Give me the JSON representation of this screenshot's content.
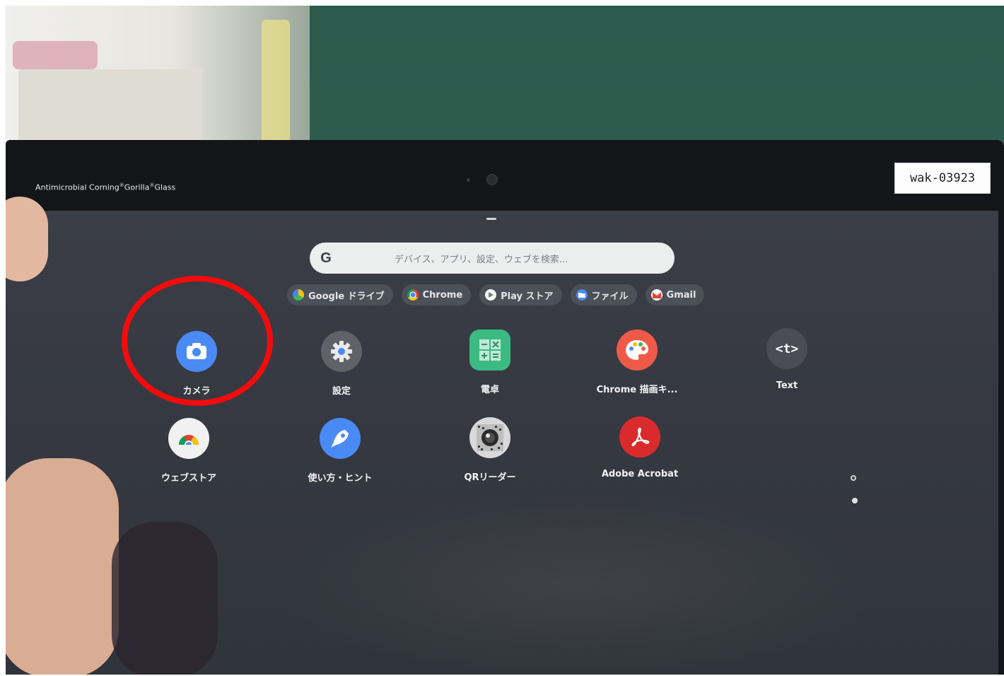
{
  "device": {
    "brand_text": "Antimicrobial Corning",
    "brand_glass_1": "Gorilla",
    "brand_glass_2": "Glass",
    "registered_mark": "®",
    "asset_tag": "wak-03923"
  },
  "search": {
    "google_logo": "G",
    "placeholder": "デバイス、アプリ、設定、ウェブを検索..."
  },
  "suggestions": [
    {
      "label": "Google ドライブ",
      "icon": "google-drive-icon"
    },
    {
      "label": "Chrome",
      "icon": "chrome-icon"
    },
    {
      "label": "Play ストア",
      "icon": "play-store-icon"
    },
    {
      "label": "ファイル",
      "icon": "files-icon"
    },
    {
      "label": "Gmail",
      "icon": "gmail-icon"
    }
  ],
  "apps": [
    {
      "label": "カメラ",
      "icon": "camera-icon",
      "color": "#4a8af4"
    },
    {
      "label": "設定",
      "icon": "settings-gear-icon",
      "color": "#5f6368"
    },
    {
      "label": "電卓",
      "icon": "calculator-icon",
      "color": "#3bba82"
    },
    {
      "label": "Chrome 描画キ...",
      "icon": "chrome-canvas-palette-icon",
      "color": "#ef5a48"
    },
    {
      "label": "Text",
      "icon": "text-app-icon",
      "color": "#4a4d55",
      "glyph": "<t>"
    },
    {
      "label": "ウェブストア",
      "icon": "web-store-icon",
      "color": "#f1f1f1"
    },
    {
      "label": "使い方・ヒント",
      "icon": "explore-rocket-icon",
      "color": "#4a8af4"
    },
    {
      "label": "QRリーダー",
      "icon": "qr-reader-icon",
      "color": "#d9d9d9"
    },
    {
      "label": "Adobe Acrobat",
      "icon": "adobe-acrobat-icon",
      "color": "#d92b2b"
    }
  ],
  "annotation": {
    "highlight_color": "#f20c0c",
    "highlighted_app": "カメラ"
  }
}
